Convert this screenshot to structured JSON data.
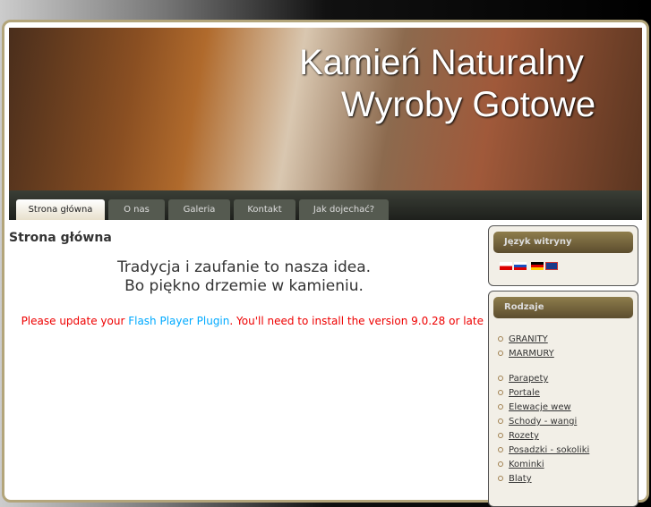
{
  "header": {
    "line1": "Kamień Naturalny",
    "line2": "Wyroby Gotowe"
  },
  "nav": [
    "Strona główna",
    "O nas",
    "Galeria",
    "Kontakt",
    "Jak dojechać?"
  ],
  "main": {
    "title": "Strona główna",
    "tagline1": "Tradycja i zaufanie to nasza idea.",
    "tagline2": "Bo piękno drzemie w kamieniu.",
    "flash_pre": "Please update your ",
    "flash_link": "Flash Player Plugin",
    "flash_post": ". You'll need to install the version 9.0.28 or late"
  },
  "sidebar": {
    "lang_title": "Język witryny",
    "flags": [
      "pl",
      "ru",
      "de",
      "en"
    ],
    "types_title": "Rodzaje",
    "group1": [
      "GRANITY",
      "MARMURY"
    ],
    "group2": [
      "Parapety",
      "Portale",
      "Elewacje wew",
      "Schody - wangi",
      "Rozety",
      "Posadzki - sokoliki",
      "Kominki",
      "Blaty"
    ]
  }
}
